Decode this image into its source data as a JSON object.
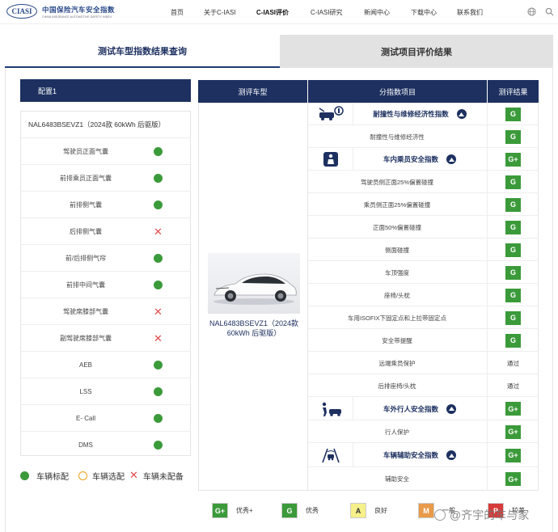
{
  "brand": {
    "logo_mark": "CIASI",
    "name_cn": "中国保险汽车安全指数",
    "name_en": "CHINA INSURANCE AUTOMOTIVE SAFETY INDEX"
  },
  "nav": {
    "items": [
      "首页",
      "关于C-IASI",
      "C-IASI评价",
      "C-IASI研究",
      "新闻中心",
      "下载中心",
      "联系我们"
    ],
    "active": "C-IASI评价",
    "icons": [
      "globe-icon",
      "search-icon"
    ]
  },
  "tabs": {
    "left": "测试车型指数结果查询",
    "right": "测试项目评价结果"
  },
  "config": {
    "header": "配置1",
    "model": "NAL6483BSEVZ1（2024款 60kWh 后驱版）",
    "features": [
      {
        "label": "驾驶员正面气囊",
        "status": "standard"
      },
      {
        "label": "前排乘员正面气囊",
        "status": "standard"
      },
      {
        "label": "前排侧气囊",
        "status": "standard"
      },
      {
        "label": "后排侧气囊",
        "status": "not_equipped"
      },
      {
        "label": "前/后排侧气帘",
        "status": "standard"
      },
      {
        "label": "前排中间气囊",
        "status": "standard"
      },
      {
        "label": "驾驶席膝部气囊",
        "status": "not_equipped"
      },
      {
        "label": "副驾驶席膝部气囊",
        "status": "not_equipped"
      },
      {
        "label": "AEB",
        "status": "standard"
      },
      {
        "label": "LSS",
        "status": "standard"
      },
      {
        "label": "E- Call",
        "status": "standard"
      },
      {
        "label": "DMS",
        "status": "standard"
      }
    ],
    "legend": {
      "standard": "车辆标配",
      "optional": "车辆选配",
      "not_equipped": "车辆未配备"
    },
    "colors": {
      "standard": "#3b9a3a",
      "optional": "#f0a020",
      "not_equipped": "#e34b4b"
    }
  },
  "results": {
    "headers": {
      "model": "测评车型",
      "index": "分指数项目",
      "result": "测评结果"
    },
    "car_name": "NAL6483BSEVZ1（2024款 60kWh 后驱版）",
    "rows": [
      {
        "kind": "category",
        "icon": "car-repair-icon",
        "label": "耐撞性与维修经济性指数",
        "result": "G"
      },
      {
        "kind": "item",
        "label": "耐撞性与维修经济性",
        "result": "G"
      },
      {
        "kind": "category",
        "icon": "seated-occupant-icon",
        "label": "车内乘员安全指数",
        "result": "G+"
      },
      {
        "kind": "item",
        "label": "驾驶员侧正面25%偏置碰撞",
        "result": "G"
      },
      {
        "kind": "item",
        "label": "乘员侧正面25%偏置碰撞",
        "result": "G"
      },
      {
        "kind": "item",
        "label": "正面50%偏置碰撞",
        "result": "G"
      },
      {
        "kind": "item",
        "label": "侧面碰撞",
        "result": "G"
      },
      {
        "kind": "item",
        "label": "车顶强度",
        "result": "G"
      },
      {
        "kind": "item",
        "label": "座椅/头枕",
        "result": "G"
      },
      {
        "kind": "item",
        "label": "车用ISOFIX下固定点和上拉带固定点",
        "result": "G"
      },
      {
        "kind": "item",
        "label": "安全带提醒",
        "result": "G"
      },
      {
        "kind": "item",
        "label": "远端乘员保护",
        "result": "通过"
      },
      {
        "kind": "item",
        "label": "后排座椅/头枕",
        "result": "通过"
      },
      {
        "kind": "category",
        "icon": "pedestrian-icon",
        "label": "车外行人安全指数",
        "result": "G+"
      },
      {
        "kind": "item",
        "label": "行人保护",
        "result": "G+"
      },
      {
        "kind": "category",
        "icon": "driver-assist-icon",
        "label": "车辆辅助安全指数",
        "result": "G+"
      },
      {
        "kind": "item",
        "label": "辅助安全",
        "result": "G+"
      }
    ]
  },
  "rating_legend": [
    {
      "code": "G+",
      "label": "优秀+",
      "color": "#3b9a3a",
      "text_color": "#ffffff"
    },
    {
      "code": "G",
      "label": "优秀",
      "color": "#3b9a3a",
      "text_color": "#ffffff"
    },
    {
      "code": "A",
      "label": "良好",
      "color": "#f5f08a",
      "text_color": "#333333"
    },
    {
      "code": "M",
      "label": "一般",
      "color": "#e89a4a",
      "text_color": "#ffffff"
    },
    {
      "code": "P",
      "label": "较差",
      "color": "#d63a3a",
      "text_color": "#ffffff"
    }
  ],
  "watermark": "@齐宇的车与家"
}
